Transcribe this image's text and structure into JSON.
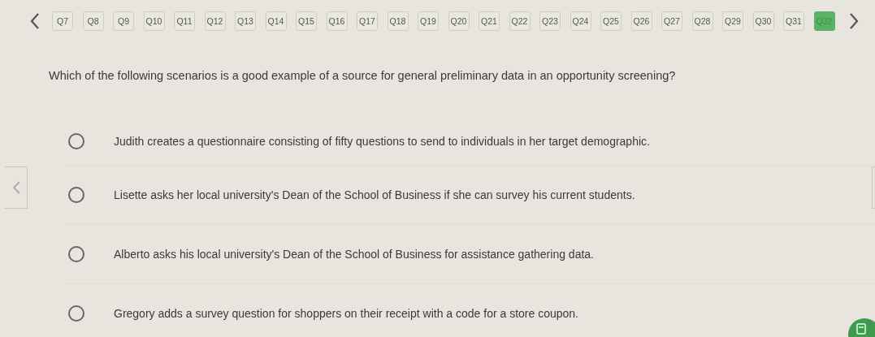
{
  "question_nav": [
    {
      "label": "Q7",
      "selected": false
    },
    {
      "label": "Q8",
      "selected": false
    },
    {
      "label": "Q9",
      "selected": false
    },
    {
      "label": "Q10",
      "selected": false
    },
    {
      "label": "Q11",
      "selected": false
    },
    {
      "label": "Q12",
      "selected": false
    },
    {
      "label": "Q13",
      "selected": false
    },
    {
      "label": "Q14",
      "selected": false
    },
    {
      "label": "Q15",
      "selected": false
    },
    {
      "label": "Q16",
      "selected": false
    },
    {
      "label": "Q17",
      "selected": false
    },
    {
      "label": "Q18",
      "selected": false
    },
    {
      "label": "Q19",
      "selected": false
    },
    {
      "label": "Q20",
      "selected": false
    },
    {
      "label": "Q21",
      "selected": false
    },
    {
      "label": "Q22",
      "selected": false
    },
    {
      "label": "Q23",
      "selected": false
    },
    {
      "label": "Q24",
      "selected": false
    },
    {
      "label": "Q25",
      "selected": false
    },
    {
      "label": "Q26",
      "selected": false
    },
    {
      "label": "Q27",
      "selected": false
    },
    {
      "label": "Q28",
      "selected": false
    },
    {
      "label": "Q29",
      "selected": false
    },
    {
      "label": "Q30",
      "selected": false
    },
    {
      "label": "Q31",
      "selected": false
    },
    {
      "label": "Q32",
      "selected": true
    }
  ],
  "question": "Which of the following scenarios is a good example of a source for general preliminary data in an opportunity screening?",
  "options": [
    {
      "text": "Judith creates a questionnaire consisting of fifty questions to send to individuals in her target demographic.",
      "selected": false
    },
    {
      "text": "Lisette asks her local university's Dean of the School of Business if she can survey his current students.",
      "selected": false
    },
    {
      "text": "Alberto asks his local university's Dean of the School of Business for assistance gathering data.",
      "selected": false
    },
    {
      "text": "Gregory adds a survey question for shoppers on their receipt with a code for a store coupon.",
      "selected": false
    }
  ]
}
